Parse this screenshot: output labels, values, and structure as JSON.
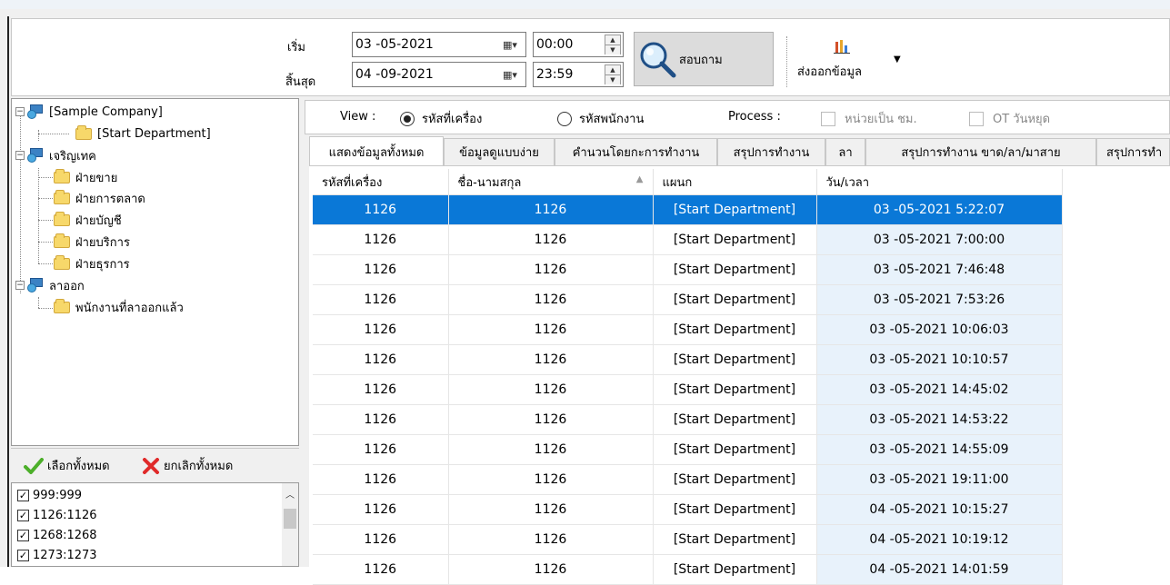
{
  "filter": {
    "start_label": "เริ่ม",
    "end_label": "สิ้นสุด",
    "start_date": "03 -05-2021",
    "end_date": "04 -09-2021",
    "start_time": "00:00",
    "end_time": "23:59",
    "query_button": "สอบถาม",
    "export_label": "ส่งออกข้อมูล"
  },
  "tree": {
    "company": "[Sample Company]",
    "start_dept": "[Start Department]",
    "group1": "เจริญเทค",
    "group1_items": [
      "ฝ่ายขาย",
      "ฝ่ายการตลาด",
      "ฝ่ายบัญชี",
      "ฝ่ายบริการ",
      "ฝ่ายธุรการ"
    ],
    "group2": "ลาออก",
    "group2_items": [
      "พนักงานที่ลาออกแล้ว"
    ]
  },
  "selection": {
    "select_all": "เลือกทั้งหมด",
    "deselect_all": "ยกเลิกทั้งหมด",
    "items": [
      "999:999",
      "1126:1126",
      "1268:1268",
      "1273:1273"
    ]
  },
  "view": {
    "label": "View :",
    "opt_machine": "รหัสที่เครื่อง",
    "opt_employee": "รหัสพนักงาน",
    "process_label": "Process :",
    "unit_hours": "หน่วยเป็น ชม.",
    "ot_holiday": "OT วันหยุด"
  },
  "tabs": [
    "แสดงข้อมูลทั้งหมด",
    "ข้อมูลดูแบบง่าย",
    "คำนวนโดยกะการทำงาน",
    "สรุปการทำงาน",
    "ลา",
    "สรุปการทำงาน ขาด/ลา/มาสาย",
    "สรุปการทำ"
  ],
  "grid": {
    "columns": [
      "รหัสที่เครื่อง",
      "ชื่อ-นามสกุล",
      "แผนก",
      "วัน/เวลา"
    ],
    "rows": [
      [
        "1126",
        "1126",
        "[Start Department]",
        "03 -05-2021 5:22:07"
      ],
      [
        "1126",
        "1126",
        "[Start Department]",
        "03 -05-2021 7:00:00"
      ],
      [
        "1126",
        "1126",
        "[Start Department]",
        "03 -05-2021 7:46:48"
      ],
      [
        "1126",
        "1126",
        "[Start Department]",
        "03 -05-2021 7:53:26"
      ],
      [
        "1126",
        "1126",
        "[Start Department]",
        "03 -05-2021 10:06:03"
      ],
      [
        "1126",
        "1126",
        "[Start Department]",
        "03 -05-2021 10:10:57"
      ],
      [
        "1126",
        "1126",
        "[Start Department]",
        "03 -05-2021 14:45:02"
      ],
      [
        "1126",
        "1126",
        "[Start Department]",
        "03 -05-2021 14:53:22"
      ],
      [
        "1126",
        "1126",
        "[Start Department]",
        "03 -05-2021 14:55:09"
      ],
      [
        "1126",
        "1126",
        "[Start Department]",
        "03 -05-2021 19:11:00"
      ],
      [
        "1126",
        "1126",
        "[Start Department]",
        "04 -05-2021 10:15:27"
      ],
      [
        "1126",
        "1126",
        "[Start Department]",
        "04 -05-2021 10:19:12"
      ],
      [
        "1126",
        "1126",
        "[Start Department]",
        "04 -05-2021 14:01:59"
      ]
    ]
  },
  "colors": {
    "selected_row": "#0a78d7",
    "datetime_col": "#e8f2fb",
    "folder": "#f7d86a"
  }
}
